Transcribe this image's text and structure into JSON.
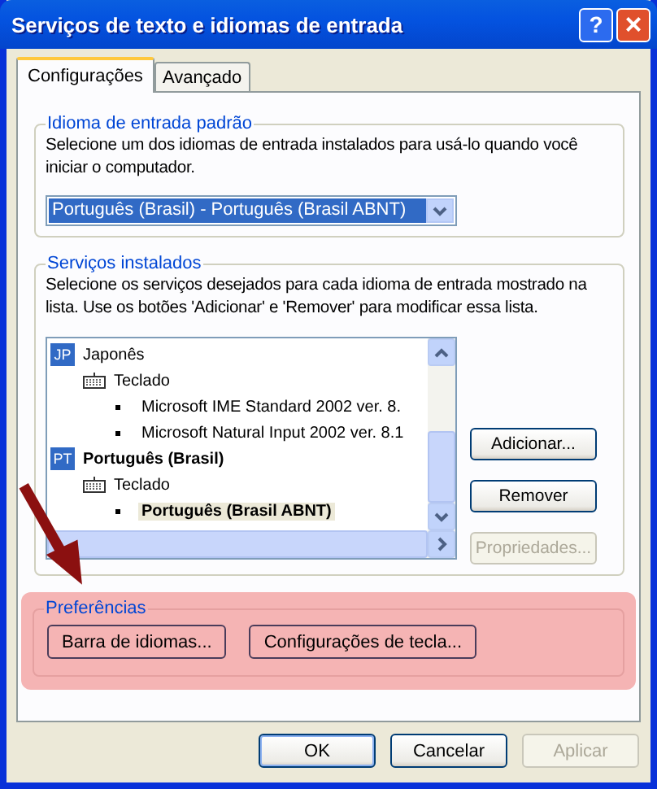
{
  "window": {
    "title": "Serviços de texto e idiomas de entrada",
    "help": "?",
    "close": "×"
  },
  "tabs": [
    {
      "label": "Configurações",
      "selected": true
    },
    {
      "label": "Avançado",
      "selected": false
    }
  ],
  "default_language": {
    "legend": "Idioma de entrada padrão",
    "description": "Selecione um dos idiomas de entrada instalados para usá-lo quando você iniciar o computador.",
    "value": "Português (Brasil) - Português (Brasil ABNT)"
  },
  "installed_services": {
    "legend": "Serviços instalados",
    "description": "Selecione os serviços desejados para cada idioma de entrada mostrado na lista. Use os botões 'Adicionar' e 'Remover' para modificar essa lista.",
    "tree": [
      {
        "badge": "JP",
        "label": "Japonês",
        "default": false,
        "children": [
          {
            "label": "Teclado",
            "children": [
              {
                "label": "Microsoft IME Standard 2002 ver. 8.",
                "default": false,
                "selected": false
              },
              {
                "label": "Microsoft Natural Input 2002 ver. 8.1",
                "default": false,
                "selected": false
              }
            ]
          }
        ]
      },
      {
        "badge": "PT",
        "label": "Português (Brasil)",
        "default": true,
        "children": [
          {
            "label": "Teclado",
            "children": [
              {
                "label": "Português (Brasil ABNT)",
                "default": true,
                "selected": true
              }
            ]
          }
        ]
      }
    ],
    "buttons": [
      {
        "label": "Adicionar...",
        "disabled": false
      },
      {
        "label": "Remover",
        "disabled": false
      },
      {
        "label": "Propriedades...",
        "disabled": true
      }
    ]
  },
  "preferences": {
    "legend": "Preferências",
    "buttons": [
      {
        "label": "Barra de idiomas..."
      },
      {
        "label": "Configurações de tecla..."
      }
    ]
  },
  "dialog_buttons": [
    {
      "label": "OK",
      "default": true,
      "disabled": false
    },
    {
      "label": "Cancelar",
      "default": false,
      "disabled": false
    },
    {
      "label": "Aplicar",
      "default": false,
      "disabled": true
    }
  ]
}
